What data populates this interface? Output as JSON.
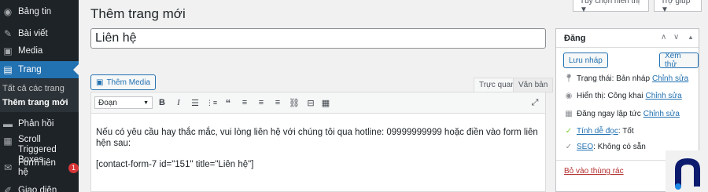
{
  "sidebar": {
    "items": [
      {
        "label": "Bảng tin",
        "icon": "dashboard-icon"
      },
      {
        "label": "Bài viết",
        "icon": "pin-icon"
      },
      {
        "label": "Media",
        "icon": "media-icon"
      },
      {
        "label": "Trang",
        "icon": "page-icon"
      },
      {
        "label": "Phản hồi",
        "icon": "comment-icon"
      },
      {
        "label": "Scroll Triggered Boxes",
        "icon": "box-icon"
      },
      {
        "label": "Form liên hệ",
        "icon": "mail-icon",
        "badge": "1"
      },
      {
        "label": "Giao diện",
        "icon": "brush-icon"
      }
    ],
    "submenu": [
      "Tất cả các trang",
      "Thêm trang mới"
    ]
  },
  "top": {
    "screen_options": "Tùy chọn hiển thị ▼",
    "help": "Trợ giúp ▼"
  },
  "page": {
    "title": "Thêm trang mới"
  },
  "post": {
    "title_value": "Liên hệ"
  },
  "editor": {
    "add_media": "Thêm Media",
    "tabs": [
      "Trực quan",
      "Văn bản"
    ],
    "format": "Đoạn",
    "content": [
      "Nếu có yêu cầu hay thắc mắc, vui lòng liên hệ với chúng tôi qua hotline: 09999999999 hoặc điền vào form liên hện sau:",
      "[contact-form-7 id=\"151\" title=\"Liên hệ\"]"
    ]
  },
  "publish": {
    "title": "Đăng",
    "save_draft": "Lưu nháp",
    "preview": "Xem thử",
    "status_label": "Trạng thái:",
    "status_value": "Bản nháp",
    "visibility_label": "Hiển thị:",
    "visibility_value": "Công khai",
    "schedule_label": "Đăng",
    "schedule_value": "ngay lập tức",
    "edit": "Chỉnh sửa",
    "readability_label": "Tính dễ đọc",
    "readability_value": ": Tốt",
    "seo_label": "SEO",
    "seo_value": ": Không có sẵn",
    "trash": "Bỏ vào thùng rác"
  },
  "colors": {
    "sidebar": "#1d2327",
    "accent": "#2271b1",
    "badge": "#d63638"
  }
}
